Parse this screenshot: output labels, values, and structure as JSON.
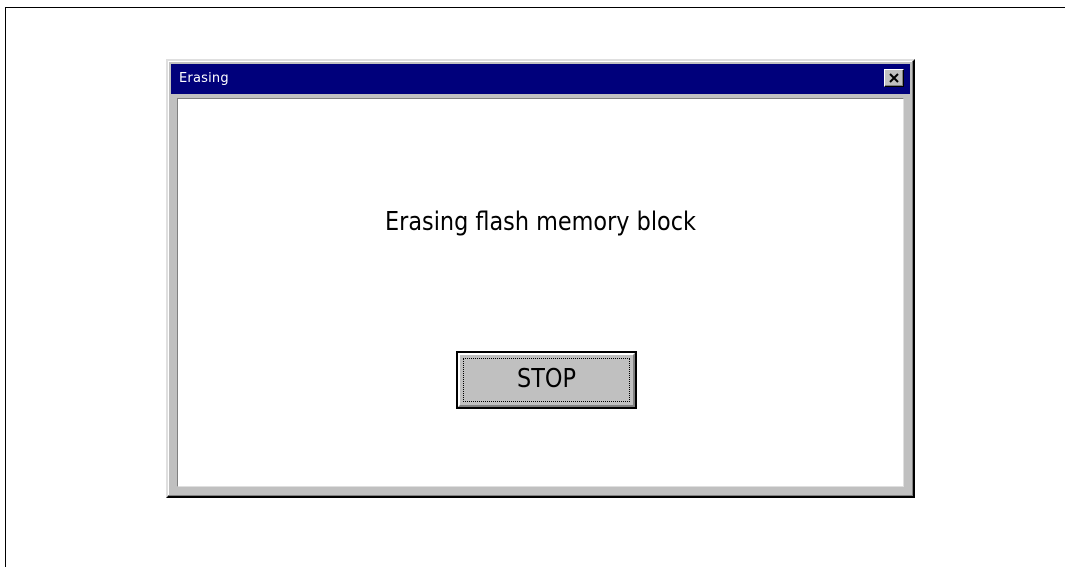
{
  "window": {
    "title": "Erasing",
    "close_icon": "close-icon"
  },
  "dialog": {
    "message": "Erasing flash memory block",
    "stop_label": "STOP"
  },
  "colors": {
    "titlebar": "#00007b",
    "face": "#c0c0c0",
    "client": "#ffffff"
  }
}
